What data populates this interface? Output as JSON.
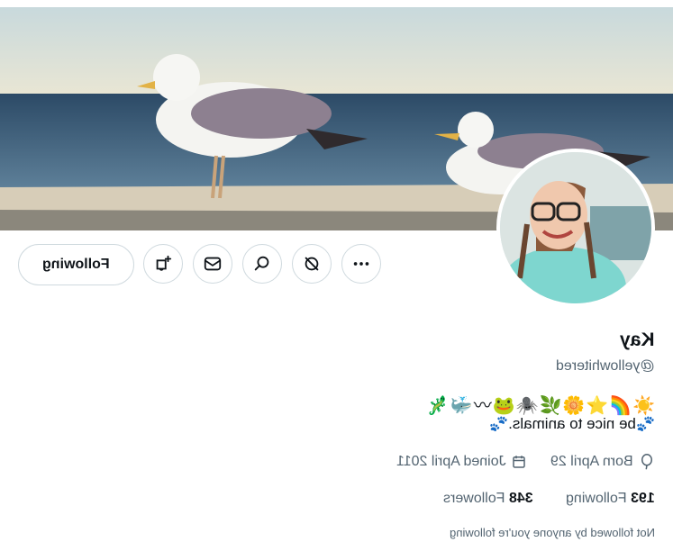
{
  "profile": {
    "name": "Kay",
    "handle": "@yellowhitered",
    "emoji_row": "☀️🌈⭐🌼🌿🕷️🐸〰🐳🦎",
    "bio": "🐾be nice to animals.🐾",
    "born": "Born April 29",
    "joined": "Joined April 2011",
    "following_count": "193",
    "following_label": "Following",
    "followers_count": "348",
    "followers_label": "Followers",
    "not_followed_note": "Not followed by anyone you're following"
  },
  "actions": {
    "following_button": "Following",
    "icons": [
      "more-icon",
      "notifications-icon",
      "search-icon",
      "message-icon",
      "subscribe-icon"
    ]
  },
  "colors": {
    "text_primary": "#0f1419",
    "text_secondary": "#536471",
    "border": "#cfd9de"
  }
}
